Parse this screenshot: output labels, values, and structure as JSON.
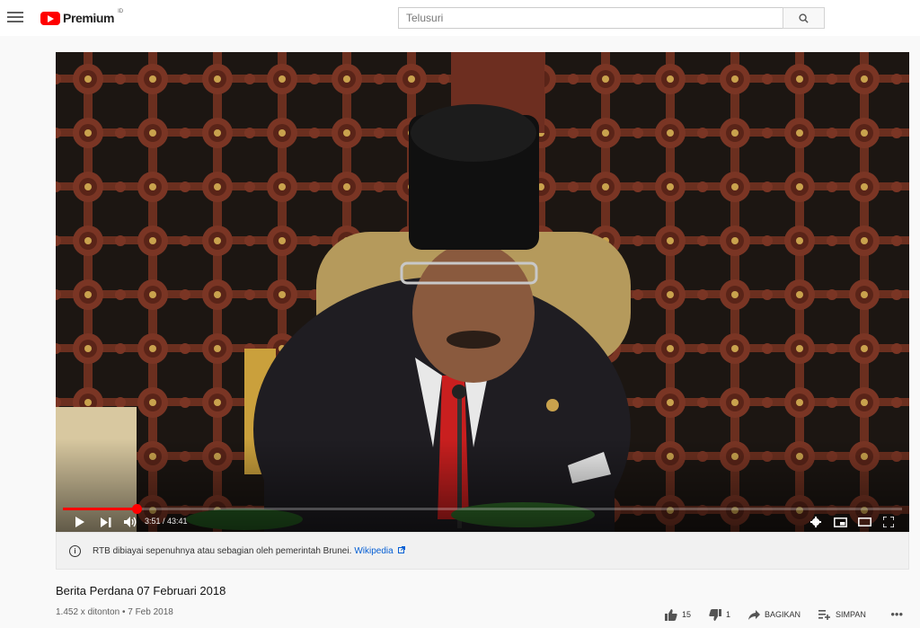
{
  "header": {
    "logo_text": "Premium",
    "region": "ID",
    "search_placeholder": "Telusuri"
  },
  "player": {
    "current_time": "3:51",
    "duration": "43:41",
    "time_display": "3:51 / 43:41",
    "progress_fraction": 0.088,
    "icons": [
      "play-icon",
      "next-icon",
      "volume-icon",
      "settings-icon",
      "miniplayer-icon",
      "theater-icon",
      "fullscreen-icon"
    ]
  },
  "info_panel": {
    "text": "RTB dibiayai sepenuhnya atau sebagian oleh pemerintah Brunei.",
    "link_label": "Wikipedia"
  },
  "video": {
    "title": "Berita Perdana 07 Februari 2018",
    "views_date": "1.452 x ditonton • 7 Feb 2018"
  },
  "actions": {
    "likes": "15",
    "dislikes": "1",
    "share_label": "BAGIKAN",
    "save_label": "SIMPAN"
  }
}
